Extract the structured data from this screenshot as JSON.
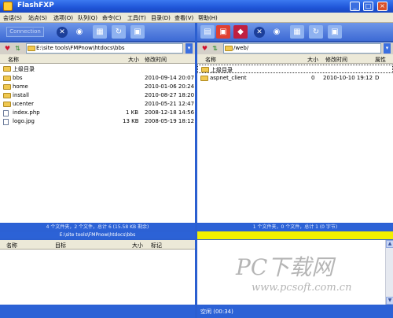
{
  "window": {
    "title": "FlashFXP"
  },
  "menu": [
    "会话(S)",
    "站点(S)",
    "选项(O)",
    "队列(Q)",
    "命令(C)",
    "工具(T)",
    "目录(D)",
    "查看(V)",
    "帮助(H)"
  ],
  "toolbar": {
    "connect_label": "Connection"
  },
  "left": {
    "path": "E:\\site tools\\FMPnow\\htdocs\\bbs",
    "columns": {
      "name": "名称",
      "size": "大小",
      "modified": "修改时间"
    },
    "up_label": "上级目录",
    "rows": [
      {
        "name": "bbs",
        "size": "",
        "date": "2010-09-14 20:07",
        "type": "folder"
      },
      {
        "name": "home",
        "size": "",
        "date": "2010-01-06 20:24",
        "type": "folder"
      },
      {
        "name": "install",
        "size": "",
        "date": "2010-08-27 18:20",
        "type": "folder"
      },
      {
        "name": "ucenter",
        "size": "",
        "date": "2010-05-21 12:47",
        "type": "folder"
      },
      {
        "name": "index.php",
        "size": "1 KB",
        "date": "2008-12-18 14:56",
        "type": "file"
      },
      {
        "name": "logo.jpg",
        "size": "13 KB",
        "date": "2008-05-19 18:12",
        "type": "file"
      }
    ],
    "status1": "4 个文件夹，2 个文件，总计 6 (15.58 KB 剩余)",
    "status2": "E:\\site tools\\FMPnow\\htdocs\\bbs"
  },
  "right": {
    "path": "/web/",
    "columns": {
      "name": "名称",
      "size": "大小",
      "modified": "修改时间",
      "attr": "属性"
    },
    "up_label": "上级目录",
    "rows": [
      {
        "name": "aspnet_client",
        "size": "0",
        "date": "2010-10-10 19:12",
        "attr": "D",
        "type": "folder"
      }
    ],
    "status1": "1 个文件夹，0 个文件，总计 1 (0 字节)"
  },
  "queue": {
    "columns": {
      "name": "名称",
      "target": "目标",
      "size": "大小",
      "note": "标记"
    }
  },
  "bottom": {
    "right_text": "空闲 (00:34)"
  },
  "watermark": {
    "big": "PC下载网",
    "small": "www.pcsoft.com.cn"
  },
  "colors": {
    "accent": "#2c62d6",
    "highlight": "#f2f000"
  }
}
